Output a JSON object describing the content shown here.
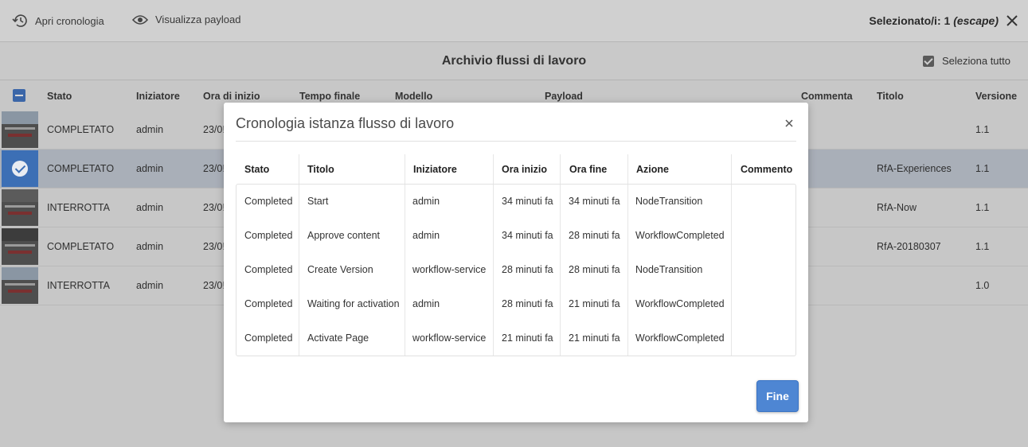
{
  "toolbar": {
    "history_label": "Apri cronologia",
    "payload_label": "Visualizza payload",
    "selection_prefix": "Selezionato/i: 1 ",
    "selection_escape": "(escape)"
  },
  "header": {
    "title": "Archivio flussi di lavoro",
    "select_all_label": "Seleziona tutto"
  },
  "table": {
    "columns": [
      "Stato",
      "Iniziatore",
      "Ora di inizio",
      "Tempo finale",
      "Modello",
      "Payload",
      "Commenta",
      "Titolo",
      "Versione"
    ],
    "rows": [
      {
        "status": "COMPLETATO",
        "initiator": "admin",
        "start": "23/0!",
        "title": "",
        "version": "1.1"
      },
      {
        "status": "COMPLETATO",
        "initiator": "admin",
        "start": "23/0!",
        "title": "RfA-Experiences",
        "version": "1.1"
      },
      {
        "status": "INTERROTTA",
        "initiator": "admin",
        "start": "23/0!",
        "title": "RfA-Now",
        "version": "1.1"
      },
      {
        "status": "COMPLETATO",
        "initiator": "admin",
        "start": "23/0!",
        "title": "RfA-20180307",
        "version": "1.1"
      },
      {
        "status": "INTERROTTA",
        "initiator": "admin",
        "start": "23/0!",
        "title": "",
        "version": "1.0"
      }
    ]
  },
  "modal": {
    "title": "Cronologia istanza flusso di lavoro",
    "columns": [
      "Stato",
      "Titolo",
      "Iniziatore",
      "Ora inizio",
      "Ora fine",
      "Azione",
      "Commento"
    ],
    "rows": [
      [
        "Completed",
        "Start",
        "admin",
        "34 minuti fa",
        "34 minuti fa",
        "NodeTransition",
        ""
      ],
      [
        "Completed",
        "Approve content",
        "admin",
        "34 minuti fa",
        "28 minuti fa",
        "WorkflowCompleted",
        ""
      ],
      [
        "Completed",
        "Create Version",
        "workflow-service",
        "28 minuti fa",
        "28 minuti fa",
        "NodeTransition",
        ""
      ],
      [
        "Completed",
        "Waiting for activation",
        "admin",
        "28 minuti fa",
        "21 minuti fa",
        "WorkflowCompleted",
        ""
      ],
      [
        "Completed",
        "Activate Page",
        "workflow-service",
        "21 minuti fa",
        "21 minuti fa",
        "WorkflowCompleted",
        ""
      ]
    ],
    "done_label": "Fine"
  },
  "colors": {
    "accent": "#4e86d3",
    "overlay_background": "#c7c7c7",
    "selected_row": "#a9afb8"
  },
  "icons": [
    "history-icon",
    "eye-icon",
    "close-icon",
    "checkbox-checked-icon",
    "checkbox-indeterminate-icon"
  ]
}
